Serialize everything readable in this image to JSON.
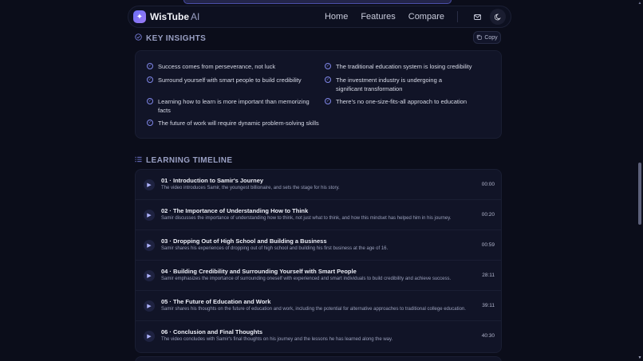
{
  "nav": {
    "brand": "WisTube",
    "brand_suffix": "AI",
    "links": [
      "Home",
      "Features",
      "Compare"
    ]
  },
  "insights": {
    "heading": "KEY INSIGHTS",
    "copy_label": "Copy",
    "items": [
      "Success comes from perseverance, not luck",
      "Surround yourself with smart people to build credibility",
      "Learning how to learn is more important than memorizing facts",
      "The future of work will require dynamic problem-solving skills",
      "The traditional education system is losing credibility",
      "The investment industry is undergoing a significant transformation",
      "There's no one-size-fits-all approach to education"
    ]
  },
  "timeline": {
    "heading": "LEARNING TIMELINE",
    "chapters": [
      {
        "title": "01 · Introduction to Samir's Journey",
        "desc": "The video introduces Samir, the youngest billionaire, and sets the stage for his story.",
        "time": "00:00"
      },
      {
        "title": "02 · The Importance of Understanding How to Think",
        "desc": "Samir discusses the importance of understanding how to think, not just what to think, and how this mindset has helped him in his journey.",
        "time": "00:20"
      },
      {
        "title": "03 · Dropping Out of High School and Building a Business",
        "desc": "Samir shares his experiences of dropping out of high school and building his first business at the age of 16.",
        "time": "00:59"
      },
      {
        "title": "04 · Building Credibility and Surrounding Yourself with Smart People",
        "desc": "Samir emphasizes the importance of surrounding oneself with experienced and smart individuals to build credibility and achieve success.",
        "time": "28:11"
      },
      {
        "title": "05 · The Future of Education and Work",
        "desc": "Samir shares his thoughts on the future of education and work, including the potential for alternative approaches to traditional college education.",
        "time": "39:11"
      },
      {
        "title": "06 · Conclusion and Final Thoughts",
        "desc": "The video concludes with Samir's final thoughts on his journey and the lessons he has learned along the way.",
        "time": "40:30"
      }
    ]
  },
  "colors": {
    "background": "#0b0d1a",
    "card": "#111427",
    "accent": "#7f86e8"
  }
}
